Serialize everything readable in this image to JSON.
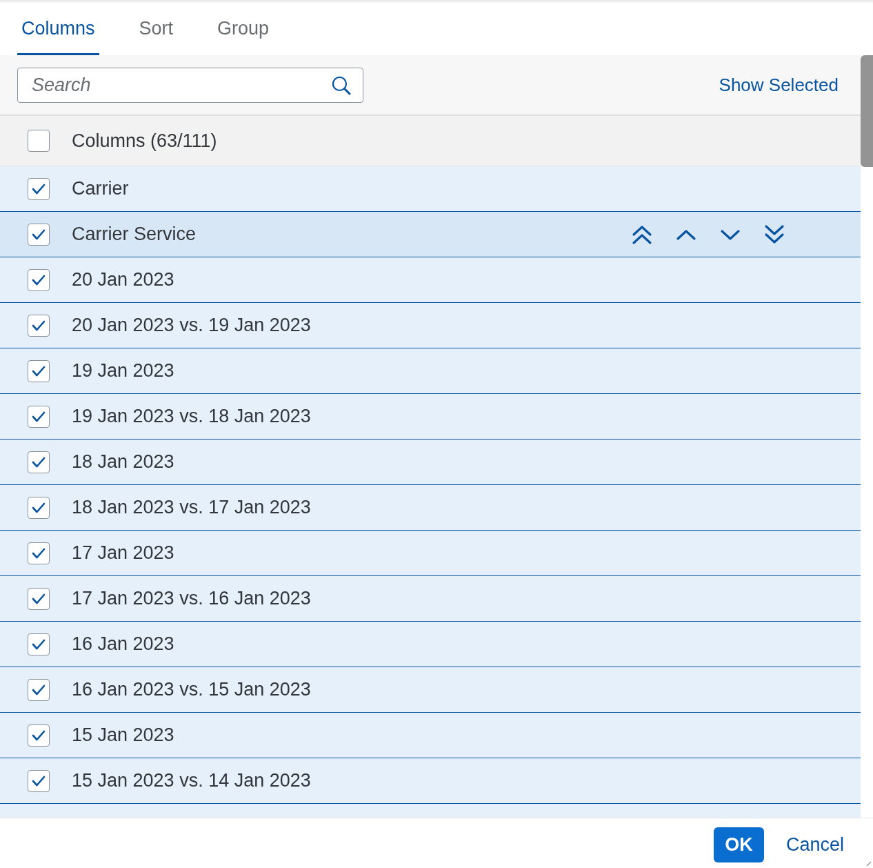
{
  "tabs": [
    {
      "label": "Columns",
      "selected": true
    },
    {
      "label": "Sort",
      "selected": false
    },
    {
      "label": "Group",
      "selected": false
    }
  ],
  "toolbar": {
    "search": {
      "placeholder": "Search"
    },
    "show_selected_link": "Show Selected"
  },
  "list_header": {
    "label": "Columns (63/111)",
    "checked": false
  },
  "rows": [
    {
      "label": "Carrier",
      "checked": true,
      "hovered": false
    },
    {
      "label": "Carrier Service",
      "checked": true,
      "hovered": true
    },
    {
      "label": "20 Jan 2023",
      "checked": true,
      "hovered": false
    },
    {
      "label": "20 Jan 2023 vs. 19 Jan 2023",
      "checked": true,
      "hovered": false
    },
    {
      "label": "19 Jan 2023",
      "checked": true,
      "hovered": false
    },
    {
      "label": "19 Jan 2023 vs. 18 Jan 2023",
      "checked": true,
      "hovered": false
    },
    {
      "label": "18 Jan 2023",
      "checked": true,
      "hovered": false
    },
    {
      "label": "18 Jan 2023 vs. 17 Jan 2023",
      "checked": true,
      "hovered": false
    },
    {
      "label": "17 Jan 2023",
      "checked": true,
      "hovered": false
    },
    {
      "label": "17 Jan 2023 vs. 16 Jan 2023",
      "checked": true,
      "hovered": false
    },
    {
      "label": "16 Jan 2023",
      "checked": true,
      "hovered": false
    },
    {
      "label": "16 Jan 2023 vs. 15 Jan 2023",
      "checked": true,
      "hovered": false
    },
    {
      "label": "15 Jan 2023",
      "checked": true,
      "hovered": false
    },
    {
      "label": "15 Jan 2023 vs. 14 Jan 2023",
      "checked": true,
      "hovered": false
    }
  ],
  "footer": {
    "buttons": [
      {
        "label": "OK",
        "kind": "primary"
      },
      {
        "label": "Cancel",
        "kind": "transparent"
      }
    ]
  }
}
